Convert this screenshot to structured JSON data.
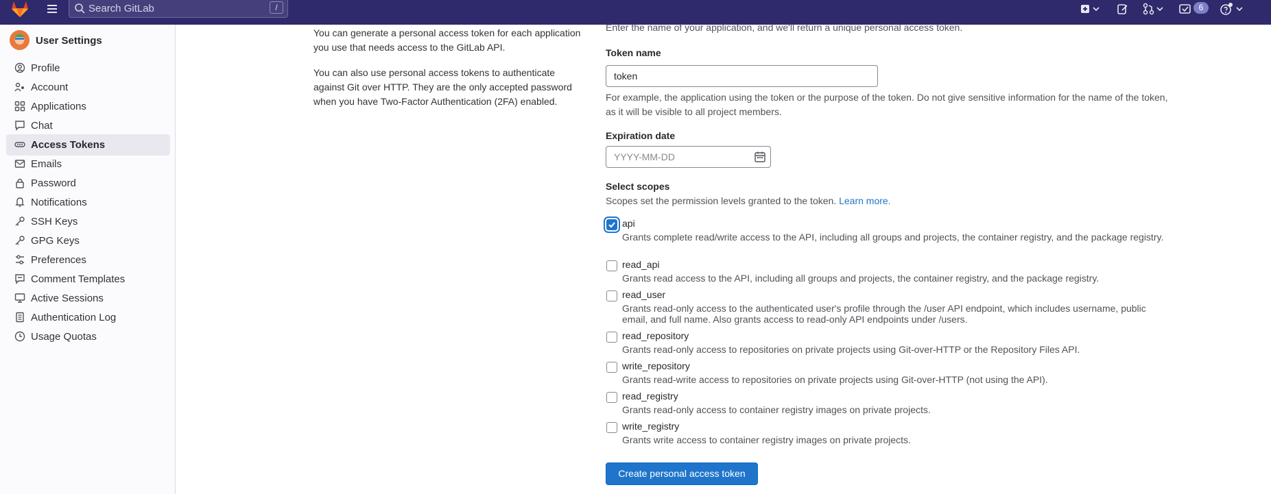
{
  "topbar": {
    "search_placeholder": "Search GitLab",
    "search_shortcut": "/",
    "todo_count": "6"
  },
  "sidebar": {
    "title": "User Settings",
    "items": [
      {
        "label": "Profile"
      },
      {
        "label": "Account"
      },
      {
        "label": "Applications"
      },
      {
        "label": "Chat"
      },
      {
        "label": "Access Tokens"
      },
      {
        "label": "Emails"
      },
      {
        "label": "Password"
      },
      {
        "label": "Notifications"
      },
      {
        "label": "SSH Keys"
      },
      {
        "label": "GPG Keys"
      },
      {
        "label": "Preferences"
      },
      {
        "label": "Comment Templates"
      },
      {
        "label": "Active Sessions"
      },
      {
        "label": "Authentication Log"
      },
      {
        "label": "Usage Quotas"
      }
    ],
    "active_item": "Access Tokens"
  },
  "description": {
    "p1": "You can generate a personal access token for each application you use that needs access to the GitLab API.",
    "p2": "You can also use personal access tokens to authenticate against Git over HTTP. They are the only accepted password when you have Two-Factor Authentication (2FA) enabled."
  },
  "form": {
    "intro": "Enter the name of your application, and we'll return a unique personal access token.",
    "token_name_label": "Token name",
    "token_name_value": "token",
    "token_name_help": "For example, the application using the token or the purpose of the token. Do not give sensitive information for the name of the token, as it will be visible to all project members.",
    "expiration_label": "Expiration date",
    "expiration_placeholder": "YYYY-MM-DD",
    "scopes_label": "Select scopes",
    "scopes_help": "Scopes set the permission levels granted to the token.",
    "scopes_link": "Learn more.",
    "submit_label": "Create personal access token"
  },
  "scopes": [
    {
      "name": "api",
      "checked": true,
      "desc": "Grants complete read/write access to the API, including all groups and projects, the container registry, and the package registry."
    },
    {
      "name": "read_api",
      "checked": false,
      "desc": "Grants read access to the API, including all groups and projects, the container registry, and the package registry."
    },
    {
      "name": "read_user",
      "checked": false,
      "desc": "Grants read-only access to the authenticated user's profile through the /user API endpoint, which includes username, public email, and full name. Also grants access to read-only API endpoints under /users."
    },
    {
      "name": "read_repository",
      "checked": false,
      "desc": "Grants read-only access to repositories on private projects using Git-over-HTTP or the Repository Files API."
    },
    {
      "name": "write_repository",
      "checked": false,
      "desc": "Grants read-write access to repositories on private projects using Git-over-HTTP (not using the API)."
    },
    {
      "name": "read_registry",
      "checked": false,
      "desc": "Grants read-only access to container registry images on private projects."
    },
    {
      "name": "write_registry",
      "checked": false,
      "desc": "Grants write access to container registry images on private projects."
    }
  ],
  "colors": {
    "topbar": "#2f2a6b",
    "primary": "#1f75cb",
    "link": "#1f75cb"
  }
}
